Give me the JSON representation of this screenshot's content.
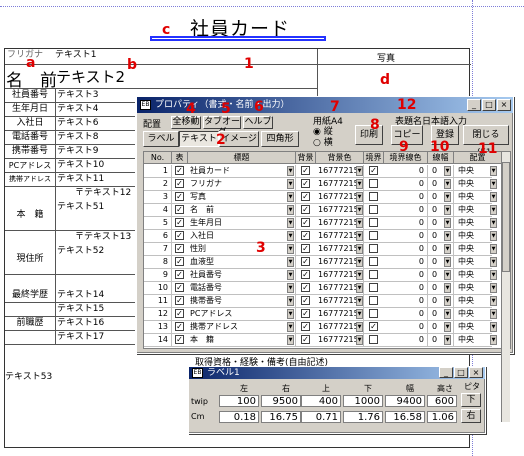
{
  "document": {
    "title": "社員カード",
    "furigana_label": "フリガナ",
    "furigana_value": "テキスト1",
    "name_label": "名　前",
    "name_value": "テキスト2",
    "photo_label": "写真",
    "text53": "テキスト53",
    "rows": [
      {
        "label": "社員番号",
        "value": "テキスト3"
      },
      {
        "label": "生年月日",
        "value": "テキスト4"
      },
      {
        "label": "入社日",
        "value": "テキスト6"
      },
      {
        "label": "電話番号",
        "value": "テキスト8"
      },
      {
        "label": "携帯番号",
        "value": "テキスト9"
      },
      {
        "label": "PCアドレス",
        "value": "テキスト10"
      },
      {
        "label": "携帯アドレス",
        "value": "テキスト11"
      }
    ],
    "honseki_label": "本　籍",
    "honseki_zip": "〒テキスト12",
    "honseki_value": "テキスト51",
    "genjusho_label": "現住所",
    "genjusho_zip": "〒テキスト13",
    "genjusho_value": "テキスト52",
    "gakureki_label": "最終学歴",
    "gakureki_value": "テキスト14",
    "t15": "テキスト15",
    "zenshokureki_label": "前職歴",
    "t16": "テキスト16",
    "t17": "テキスト17",
    "footer_text": "取得資格・経験・備考(自由記述)"
  },
  "red_markers": {
    "a": "a",
    "b": "b",
    "c": "c",
    "d": "d",
    "n1": "1",
    "n2": "2",
    "n3": "3",
    "n4": "4",
    "n5": "5",
    "n6": "6",
    "n7": "7",
    "n8": "8",
    "n9": "9",
    "n10": "10",
    "n11": "11",
    "n12": "12"
  },
  "prop_window": {
    "title": "プロパティ（書式・名前・出力）",
    "group_label": "配置",
    "btn_all_move": "全移動",
    "btn_tab_order": "タブオーダ",
    "btn_help": "ヘルプ",
    "tab_label": "ラベル",
    "tab_text": "テキスト",
    "tab_image": "イメージ",
    "tab_rect": "四角形",
    "paper_label": "用紙A4",
    "radio_portrait": "縦",
    "radio_landscape": "横",
    "btn_print": "印刷",
    "btn_copy": "コピー",
    "btn_register": "登録",
    "btn_close": "閉じる(F1)",
    "table_name_input": "表題名日本語入力",
    "columns": [
      "No.",
      "表示",
      "標題",
      "背景",
      "背景色",
      "境界",
      "境界線色",
      "線幅",
      "配置"
    ],
    "rows": [
      {
        "no": "1",
        "title": "社員カード",
        "color": "16777215",
        "border": true,
        "width": "0",
        "align": "中央"
      },
      {
        "no": "2",
        "title": "フリガナ",
        "color": "16777215",
        "border": false,
        "width": "0",
        "align": "中央"
      },
      {
        "no": "3",
        "title": "写真",
        "color": "16777215",
        "border": false,
        "width": "0",
        "align": "中央"
      },
      {
        "no": "4",
        "title": "名　前",
        "color": "16777215",
        "border": false,
        "width": "0",
        "align": "中央"
      },
      {
        "no": "5",
        "title": "生年月日",
        "color": "16777215",
        "border": false,
        "width": "0",
        "align": "中央"
      },
      {
        "no": "6",
        "title": "入社日",
        "color": "16777215",
        "border": false,
        "width": "0",
        "align": "中央"
      },
      {
        "no": "7",
        "title": "性別",
        "color": "16777215",
        "border": false,
        "width": "0",
        "align": "中央"
      },
      {
        "no": "8",
        "title": "血液型",
        "color": "16777215",
        "border": false,
        "width": "0",
        "align": "中央"
      },
      {
        "no": "9",
        "title": "社員番号",
        "color": "16777215",
        "border": false,
        "width": "0",
        "align": "中央"
      },
      {
        "no": "10",
        "title": "電話番号",
        "color": "16777215",
        "border": false,
        "width": "0",
        "align": "中央"
      },
      {
        "no": "11",
        "title": "携帯番号",
        "color": "16777215",
        "border": false,
        "width": "0",
        "align": "中央"
      },
      {
        "no": "12",
        "title": "PCアドレス",
        "color": "16777215",
        "border": false,
        "width": "0",
        "align": "中央"
      },
      {
        "no": "13",
        "title": "携帯アドレス",
        "color": "16777215",
        "border": true,
        "width": "0",
        "align": "中央"
      },
      {
        "no": "14",
        "title": "本　籍",
        "color": "16777215",
        "border": false,
        "width": "0",
        "align": "中央"
      }
    ]
  },
  "label_window": {
    "title": "ラベル1",
    "headers": [
      "左",
      "右",
      "上",
      "下",
      "幅",
      "高さ",
      "ピタ"
    ],
    "twip_label": "twip",
    "twip_values": [
      "100",
      "9500",
      "400",
      "1000",
      "9400",
      "600"
    ],
    "cm_label": "Cm",
    "cm_values": [
      "0.18",
      "16.75",
      "0.71",
      "1.76",
      "16.58",
      "1.06"
    ],
    "btn_down": "下",
    "btn_right": "右"
  },
  "colors": {
    "title_blue": "#0a246a",
    "marker_red": "#e00000",
    "box_blue": "#2432ff"
  }
}
